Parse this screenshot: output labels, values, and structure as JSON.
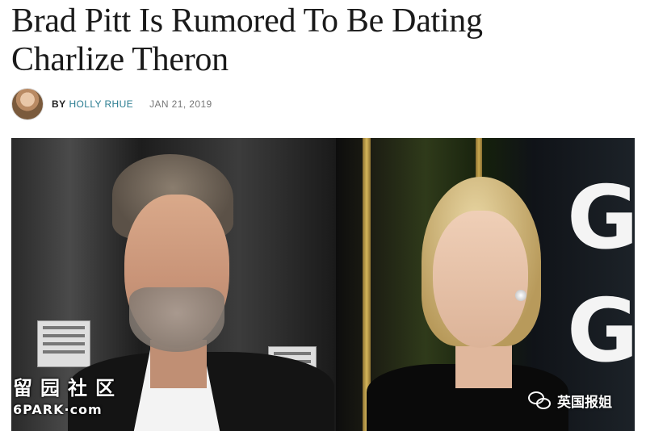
{
  "article": {
    "headline_line1": "Brad Pitt Is Rumored To Be Dating",
    "headline_line2": "Charlize Theron",
    "byline_prefix": "BY",
    "author": "HOLLY RHUE",
    "date": "JAN 21, 2019"
  },
  "photo": {
    "left_sign_text": "J/P HAITIAN RELIEF ORGANIZATION PRODUCTION OFFICE",
    "backdrop_text": "GO GL"
  },
  "watermarks": {
    "left_cn": "留园社区",
    "left_en": "6PARK·com",
    "right_text": "英国报姐"
  },
  "colors": {
    "author_link": "#2b7d91",
    "date": "#777777"
  }
}
